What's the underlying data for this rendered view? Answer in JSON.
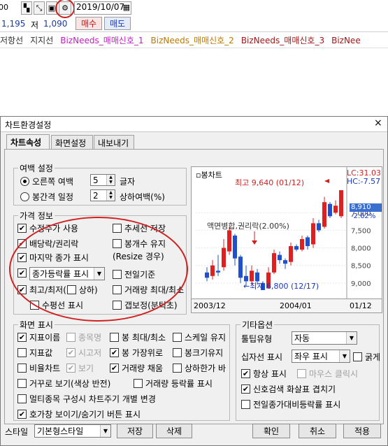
{
  "toolbar": {
    "left_partial": "00",
    "date": "2019/10/07",
    "price1": "1,195",
    "low_label": "저",
    "price2": "1,090",
    "buy_label": "매수",
    "sell_label": "매도"
  },
  "legend": [
    {
      "text": "저항선",
      "color": "#333333"
    },
    {
      "text": "지지선",
      "color": "#333333"
    },
    {
      "text": "BizNeeds_매매신호_1",
      "color": "#c020c0"
    },
    {
      "text": "BizNeeds_매매신호_2",
      "color": "#c07800"
    },
    {
      "text": "BizNeeds_매매신호_3",
      "color": "#a01818"
    },
    {
      "text": "BizNee",
      "color": "#a01818"
    }
  ],
  "dialog": {
    "title": "차트환경설정",
    "close": "×",
    "tabs": [
      "차트속성",
      "화면설정",
      "내보내기"
    ],
    "margin": {
      "title": "여백 설정",
      "right_margin_label": "오른쪽 여백",
      "right_margin_value": "5",
      "right_margin_unit": "글자",
      "interval_label": "봉간격 일정",
      "interval_value": "2",
      "interval_unit": "상하여백(%)"
    },
    "price_info": {
      "title": "가격 정보",
      "adj_price": "수정주가 사용",
      "trend_save": "추세선 저장",
      "dividend": "배당락/권리락",
      "candle_keep": "봉개수 유지",
      "resize_note": "(Resize 경우)",
      "last_close": "마지막 종가 표시",
      "change_select": "종가등락률 표시",
      "prev_day": "전일기준",
      "high_low": "최고/최저(",
      "high_low_opt": "상하)",
      "vol_max": "거래량 최대/최소",
      "horizon": "수평선 표시",
      "gap": "갭보정(분틱초)"
    },
    "preview": {
      "title": "봉차트",
      "high_text": "최고 9,640 (01/12)",
      "low_text": "←최저 6,800 (12/17)",
      "merge_text": "액면병합,권리락(2.00%)",
      "lc": "LC:31.03",
      "hc": "HC:-7.57",
      "price_tag": "8,910",
      "pct_tag": "-2.62%",
      "ticks": [
        "9,000",
        "8,500",
        "8,000",
        "7,500",
        "7,000"
      ],
      "x_labels": [
        "2003/12",
        "2004/01",
        "01/12"
      ]
    },
    "screen": {
      "title": "화면 표시",
      "indicator_name": "지표이름",
      "item_name": "종목명",
      "candle_max": "봉 최대/최소",
      "scale_keep": "스케일 유지",
      "indicator_value": "지표값",
      "high_low_x": "시고저",
      "candle_top": "봉 가장위로",
      "candle_max_size": "봉크기유지",
      "ratio_chart": "비율차트",
      "view": "보기",
      "vol_fill": "거래량 채움",
      "upper_lower": "상하한가 바",
      "reverse": "거꾸로 보기(색상 반전)",
      "vol_change": "거래량 등락률 표시",
      "multi_item": "멀티종목 구성시 차트주기 개별 변경",
      "hide_btn": "호가창 보이기/숨기기 버튼 표시"
    },
    "other": {
      "title": "기타옵션",
      "tooltip_label": "툴팁유형",
      "tooltip_value": "자동",
      "cross_label": "십자선 표시",
      "cross_value": "좌우 표시",
      "bold": "굵게",
      "always": "항상 표시",
      "mouse_click": "마우스 클릭시",
      "signal": "신호검색 화살표 겹치기",
      "prev_change": "전일종가대비등락률 표시"
    },
    "bottom": {
      "style_label": "스타일",
      "style_value": "기본형스타일",
      "save": "저장",
      "delete": "삭제",
      "ok": "확인",
      "cancel": "취소",
      "apply": "적용"
    }
  },
  "chart_data": {
    "type": "candlestick",
    "title": "봉차트",
    "ylim": [
      6600,
      9900
    ],
    "y_ticks": [
      7000,
      7500,
      8000,
      8500,
      9000
    ],
    "x_labels": [
      "2003/12",
      "2004/01",
      "01/12"
    ],
    "annotations": [
      "최고 9,640 (01/12)",
      "최저 6,800 (12/17)",
      "액면병합,권리락(2.00%)"
    ],
    "candles": [
      {
        "o": 7300,
        "c": 7150,
        "h": 7450,
        "l": 7050
      },
      {
        "o": 7200,
        "c": 7500,
        "h": 7650,
        "l": 7100
      },
      {
        "o": 7350,
        "c": 7300,
        "h": 7800,
        "l": 7200
      },
      {
        "o": 7450,
        "c": 8000,
        "h": 8250,
        "l": 7350
      },
      {
        "o": 7900,
        "c": 8500,
        "h": 8600,
        "l": 7800
      },
      {
        "o": 8350,
        "c": 7700,
        "h": 8400,
        "l": 7500
      },
      {
        "o": 7750,
        "c": 7150,
        "h": 7800,
        "l": 7000
      },
      {
        "o": 7200,
        "c": 7050,
        "h": 7500,
        "l": 6900
      },
      {
        "o": 7050,
        "c": 7350,
        "h": 7500,
        "l": 6950
      },
      {
        "o": 7300,
        "c": 7050,
        "h": 7400,
        "l": 6950
      },
      {
        "o": 7000,
        "c": 6800,
        "h": 7050,
        "l": 6800
      },
      {
        "o": 6850,
        "c": 7300,
        "h": 7450,
        "l": 6850
      },
      {
        "o": 7300,
        "c": 7850,
        "h": 7950,
        "l": 7250
      },
      {
        "o": 7800,
        "c": 7650,
        "h": 7900,
        "l": 7550
      },
      {
        "o": 7650,
        "c": 7550,
        "h": 7700,
        "l": 7400
      },
      {
        "o": 7600,
        "c": 8050,
        "h": 8150,
        "l": 7500
      },
      {
        "o": 8050,
        "c": 7950,
        "h": 8100,
        "l": 7900
      },
      {
        "o": 7950,
        "c": 8250,
        "h": 8350,
        "l": 7900
      },
      {
        "o": 8300,
        "c": 8050,
        "h": 8350,
        "l": 7950
      },
      {
        "o": 8100,
        "c": 8700,
        "h": 8850,
        "l": 8000
      },
      {
        "o": 8700,
        "c": 8500,
        "h": 8800,
        "l": 8450
      },
      {
        "o": 8600,
        "c": 9300,
        "h": 9450,
        "l": 8550
      },
      {
        "o": 9250,
        "c": 8900,
        "h": 9300,
        "l": 8850
      },
      {
        "o": 9000,
        "c": 9200,
        "h": 9350,
        "l": 8950
      },
      {
        "o": 8900,
        "c": 9640,
        "h": 9640,
        "l": 8850
      }
    ]
  }
}
